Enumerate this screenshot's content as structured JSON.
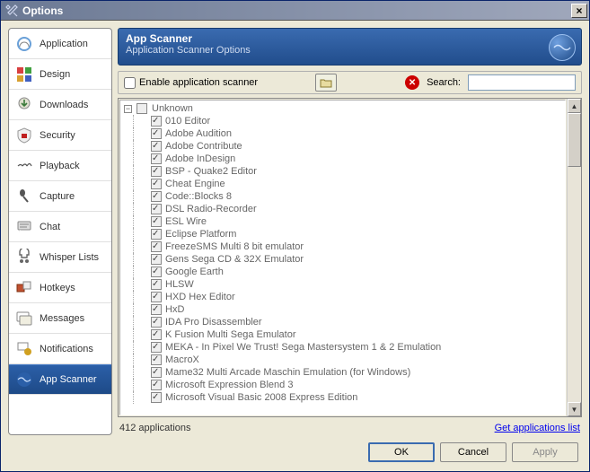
{
  "window": {
    "title": "Options",
    "close_label": "×"
  },
  "sidenav": {
    "items": [
      {
        "label": "Application",
        "icon": "headset-icon"
      },
      {
        "label": "Design",
        "icon": "grid-icon"
      },
      {
        "label": "Downloads",
        "icon": "download-icon"
      },
      {
        "label": "Security",
        "icon": "shield-icon"
      },
      {
        "label": "Playback",
        "icon": "sound-icon"
      },
      {
        "label": "Capture",
        "icon": "mic-icon"
      },
      {
        "label": "Chat",
        "icon": "chat-icon"
      },
      {
        "label": "Whisper Lists",
        "icon": "whisper-icon"
      },
      {
        "label": "Hotkeys",
        "icon": "hotkeys-icon"
      },
      {
        "label": "Messages",
        "icon": "message-icon"
      },
      {
        "label": "Notifications",
        "icon": "bell-icon"
      },
      {
        "label": "App Scanner",
        "icon": "scanner-icon",
        "selected": true
      }
    ]
  },
  "header": {
    "title": "App Scanner",
    "subtitle": "Application Scanner Options"
  },
  "toolbar": {
    "enable_label": "Enable application scanner",
    "enable_checked": false,
    "search_label": "Search:",
    "search_value": ""
  },
  "tree": {
    "root_label": "Unknown",
    "collapse_symbol": "−",
    "items": [
      "010 Editor",
      "Adobe Audition",
      "Adobe Contribute",
      "Adobe InDesign",
      "BSP - Quake2 Editor",
      "Cheat Engine",
      "Code::Blocks 8",
      "DSL Radio-Recorder",
      "ESL Wire",
      "Eclipse Platform",
      "FreezeSMS Multi 8 bit emulator",
      "Gens Sega CD & 32X Emulator",
      "Google Earth",
      "HLSW",
      "HXD Hex Editor",
      "HxD",
      "IDA Pro Disassembler",
      "K Fusion Multi Sega Emulator",
      "MEKA - In Pixel We Trust! Sega Mastersystem 1 & 2 Emulation",
      "MacroX",
      "Mame32 Multi Arcade Maschin Emulation (for Windows)",
      "Microsoft Expression Blend 3",
      "Microsoft Visual Basic 2008 Express Edition"
    ]
  },
  "status": {
    "count_text": "412 applications",
    "link_text": "Get applications list"
  },
  "buttons": {
    "ok": "OK",
    "cancel": "Cancel",
    "apply": "Apply"
  }
}
